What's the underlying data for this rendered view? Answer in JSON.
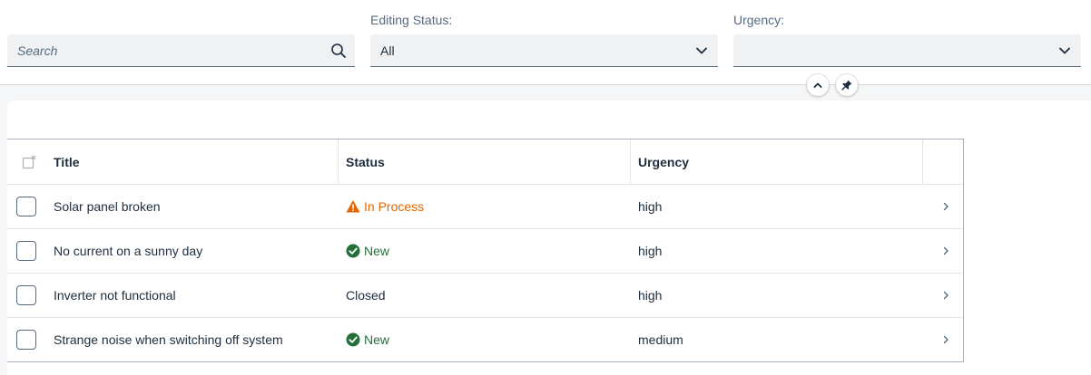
{
  "filter_bar": {
    "search": {
      "placeholder": "Search",
      "icon": "search-icon"
    },
    "editing_status": {
      "label": "Editing Status:",
      "value": "All",
      "icon": "chevron-down-icon"
    },
    "urgency": {
      "label": "Urgency:",
      "value": "",
      "icon": "chevron-down-icon"
    },
    "collapse_icon": "chevron-up-icon",
    "pin_icon": "pin-icon"
  },
  "table": {
    "columns": [
      "Title",
      "Status",
      "Urgency"
    ],
    "rows": [
      {
        "title": "Solar panel broken",
        "status": "In Process",
        "status_state": "warning",
        "urgency": "high"
      },
      {
        "title": "No current on a sunny day",
        "status": "New",
        "status_state": "success",
        "urgency": "high"
      },
      {
        "title": "Inverter not functional",
        "status": "Closed",
        "status_state": "none",
        "urgency": "high"
      },
      {
        "title": "Strange noise when switching off system",
        "status": "New",
        "status_state": "success",
        "urgency": "medium"
      }
    ]
  },
  "colors": {
    "warning": "#e76500",
    "success": "#256f3a",
    "text": "#1d2d3e",
    "label": "#556b82"
  }
}
